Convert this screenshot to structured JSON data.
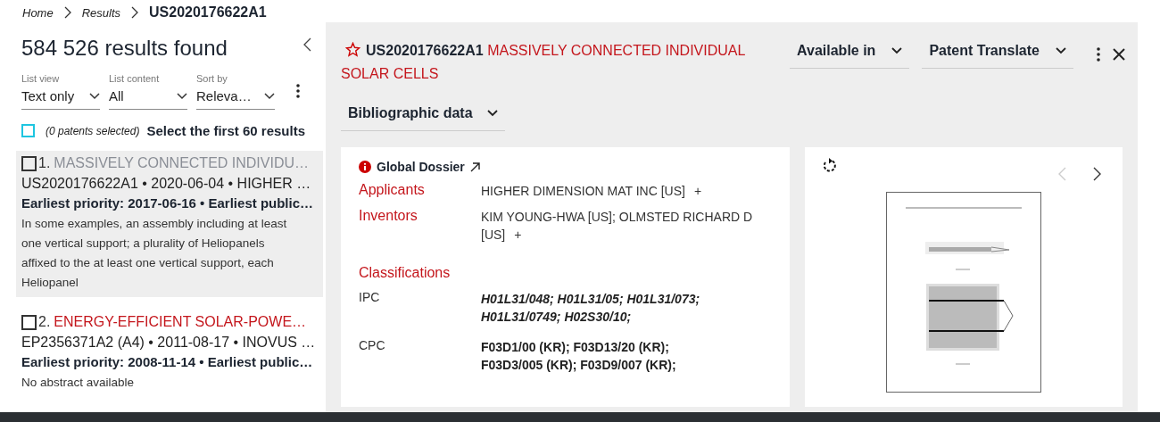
{
  "breadcrumb": [
    {
      "label": "Home",
      "kind": "link"
    },
    {
      "label": "Results",
      "kind": "link"
    },
    {
      "label": "US2020176622A1",
      "kind": "current"
    }
  ],
  "results_panel": {
    "count": "584 526 results found",
    "filters": [
      {
        "label": "List view",
        "value": "Text only"
      },
      {
        "label": "List content",
        "value": "All"
      },
      {
        "label": "Sort by",
        "value": "Releva…"
      }
    ],
    "select_all": {
      "checked": false,
      "note": "(0 patents selected)",
      "action": "Select the first 60 results"
    },
    "results": [
      {
        "checked": false,
        "selected": true,
        "number": "1.",
        "title": "MASSIVELY CONNECTED INDIVIDU…",
        "meta": "US2020176622A1 • 2020-06-04 • HIGHER …",
        "priority": "Earliest priority: 2017-06-16 • Earliest public…",
        "abstract": "In some examples, an assembly including at least one vertical support; a plurality of Heliopanels affixed to the at least one vertical support, each Heliopanel"
      },
      {
        "checked": false,
        "selected": false,
        "number": "2.",
        "title": "ENERGY-EFFICIENT SOLAR-POWE…",
        "meta": "EP2356371A2 (A4) • 2011-08-17 • INOVUS …",
        "priority": "Earliest priority: 2008-11-14 • Earliest public…",
        "abstract": "No abstract available"
      }
    ]
  },
  "detail": {
    "starred": false,
    "number": "US2020176622A1",
    "title": "MASSIVELY CONNECTED INDIVIDUAL SOLAR CELLS",
    "menus": [
      "Available in",
      "Patent Translate"
    ],
    "section_menu": "Bibliographic data",
    "global_dossier": "Global Dossier",
    "parties": [
      {
        "label": "Applicants",
        "value": "HIGHER DIMENSION MAT INC [US]",
        "action": "+"
      },
      {
        "label": "Inventors",
        "value": "KIM YOUNG-HWA [US]; OLMSTED RICHARD D [US]",
        "action": "+"
      }
    ],
    "classifications_heading": "Classifications",
    "classifications": [
      {
        "label": "IPC",
        "value": "H01L31/048; H01L31/05; H01L31/073; H01L31/0749; H02S30/10;",
        "italic": true
      },
      {
        "label": "CPC",
        "value": "F03D1/00 (KR); F03D13/20 (KR); F03D3/005 (KR); F03D9/007 (KR);",
        "italic": false
      }
    ],
    "viewer": {
      "prev_disabled": true,
      "next_disabled": false
    }
  }
}
